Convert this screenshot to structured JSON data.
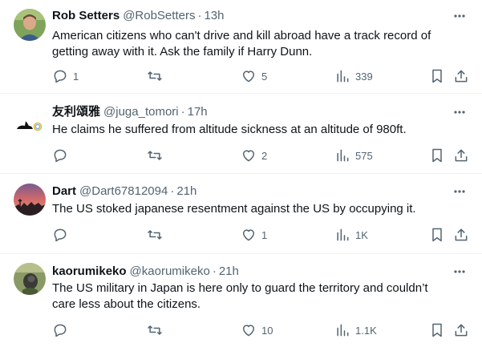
{
  "tweets": [
    {
      "display_name": "Rob Setters",
      "handle": "@RobSetters",
      "time": "13h",
      "text": "American citizens who can't drive and kill abroad have a track record of getting away with it. Ask the family if Harry Dunn.",
      "replies": "1",
      "retweets": "",
      "likes": "5",
      "views": "339",
      "avatar_color": "#6f8f4f"
    },
    {
      "display_name": "友利頌雅",
      "handle": "@juga_tomori",
      "time": "17h",
      "text": "He claims he suffered from altitude sickness at an altitude of 980ft.",
      "replies": "",
      "retweets": "",
      "likes": "2",
      "views": "575",
      "avatar_color": "#ffffff"
    },
    {
      "display_name": "Dart",
      "handle": "@Dart67812094",
      "time": "21h",
      "text": "The US stoked japanese resentment against the US by occupying it.",
      "replies": "",
      "retweets": "",
      "likes": "1",
      "views": "1K",
      "avatar_color": "#b5545c"
    },
    {
      "display_name": "kaorumikeko",
      "handle": "@kaorumikeko",
      "time": "21h",
      "text": "The US military in Japan is here only to guard the territory and couldn’t care less about the citizens.",
      "replies": "",
      "retweets": "",
      "likes": "10",
      "views": "1.1K",
      "avatar_color": "#7d8b5a"
    }
  ],
  "separator": "·",
  "icons": {
    "reply": "reply-icon",
    "retweet": "retweet-icon",
    "like": "heart-icon",
    "views": "views-icon",
    "bookmark": "bookmark-icon",
    "share": "share-icon",
    "more": "more-icon"
  },
  "colors": {
    "text": "#0f1419",
    "secondary": "#536471",
    "divider": "#eff3f4"
  }
}
